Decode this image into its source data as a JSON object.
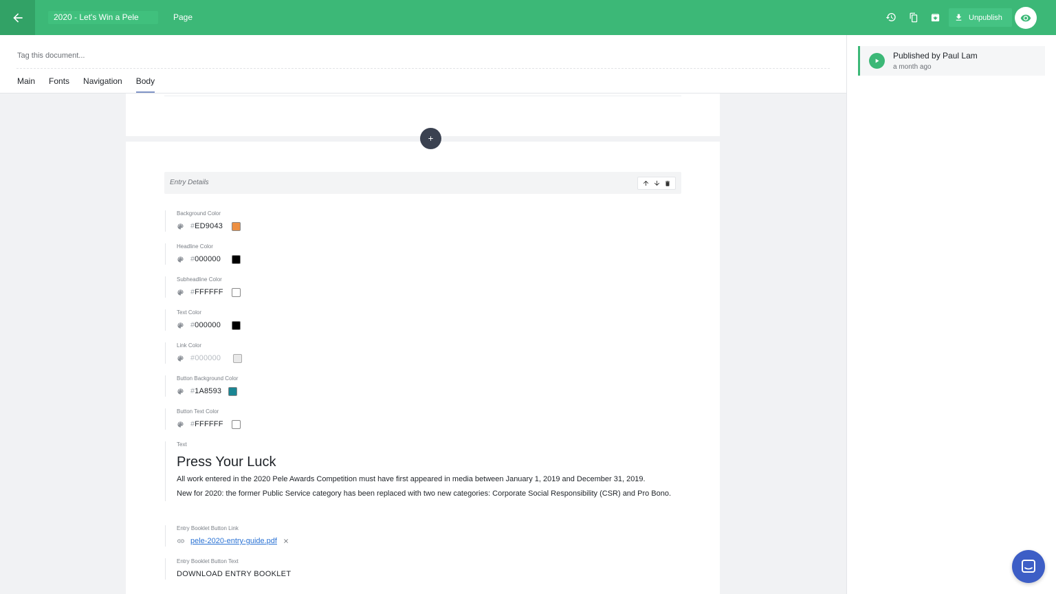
{
  "topbar": {
    "title": "2020 - Let's Win a Pele",
    "doc_type": "Page",
    "unpublish_label": "Unpublish",
    "accent": "#3cb877"
  },
  "doc_header": {
    "tag_placeholder": "Tag this document...",
    "tabs": [
      {
        "label": "Main",
        "active": false
      },
      {
        "label": "Fonts",
        "active": false
      },
      {
        "label": "Navigation",
        "active": false
      },
      {
        "label": "Body",
        "active": true
      }
    ]
  },
  "activity": {
    "title": "Published by Paul Lam",
    "time": "a month ago"
  },
  "slice": {
    "title": "Entry Details",
    "colors": [
      {
        "label": "Background Color",
        "hex": "ED9043",
        "swatch": "#ED9043",
        "muted": false
      },
      {
        "label": "Headline Color",
        "hex": "000000",
        "swatch": "#000000",
        "muted": false
      },
      {
        "label": "Subheadline Color",
        "hex": "FFFFFF",
        "swatch": "#FFFFFF",
        "muted": false
      },
      {
        "label": "Text Color",
        "hex": "000000",
        "swatch": "#000000",
        "muted": false
      },
      {
        "label": "Link Color",
        "hex": "#000000",
        "swatch": "#e9e9e9",
        "muted": true
      },
      {
        "label": "Button Background Color",
        "hex": "1A8593",
        "swatch": "#1A8593",
        "muted": false
      },
      {
        "label": "Button Text Color",
        "hex": "FFFFFF",
        "swatch": "#FFFFFF",
        "muted": false
      }
    ],
    "text_field": {
      "label": "Text",
      "heading": "Press Your Luck",
      "paragraph_1": "All work entered in the 2020 Pele Awards Competition must have first appeared in media between January 1, 2019 and December 31, 2019.",
      "paragraph_2": "New for 2020: the former Public Service category has been replaced with two new categories: Corporate Social Responsibility (CSR) and Pro Bono."
    },
    "link_field": {
      "label": "Entry Booklet Button Link",
      "file": "pele-2020-entry-guide.pdf"
    },
    "button_text_field": {
      "label": "Entry Booklet Button Text",
      "value": "DOWNLOAD ENTRY BOOKLET"
    }
  }
}
